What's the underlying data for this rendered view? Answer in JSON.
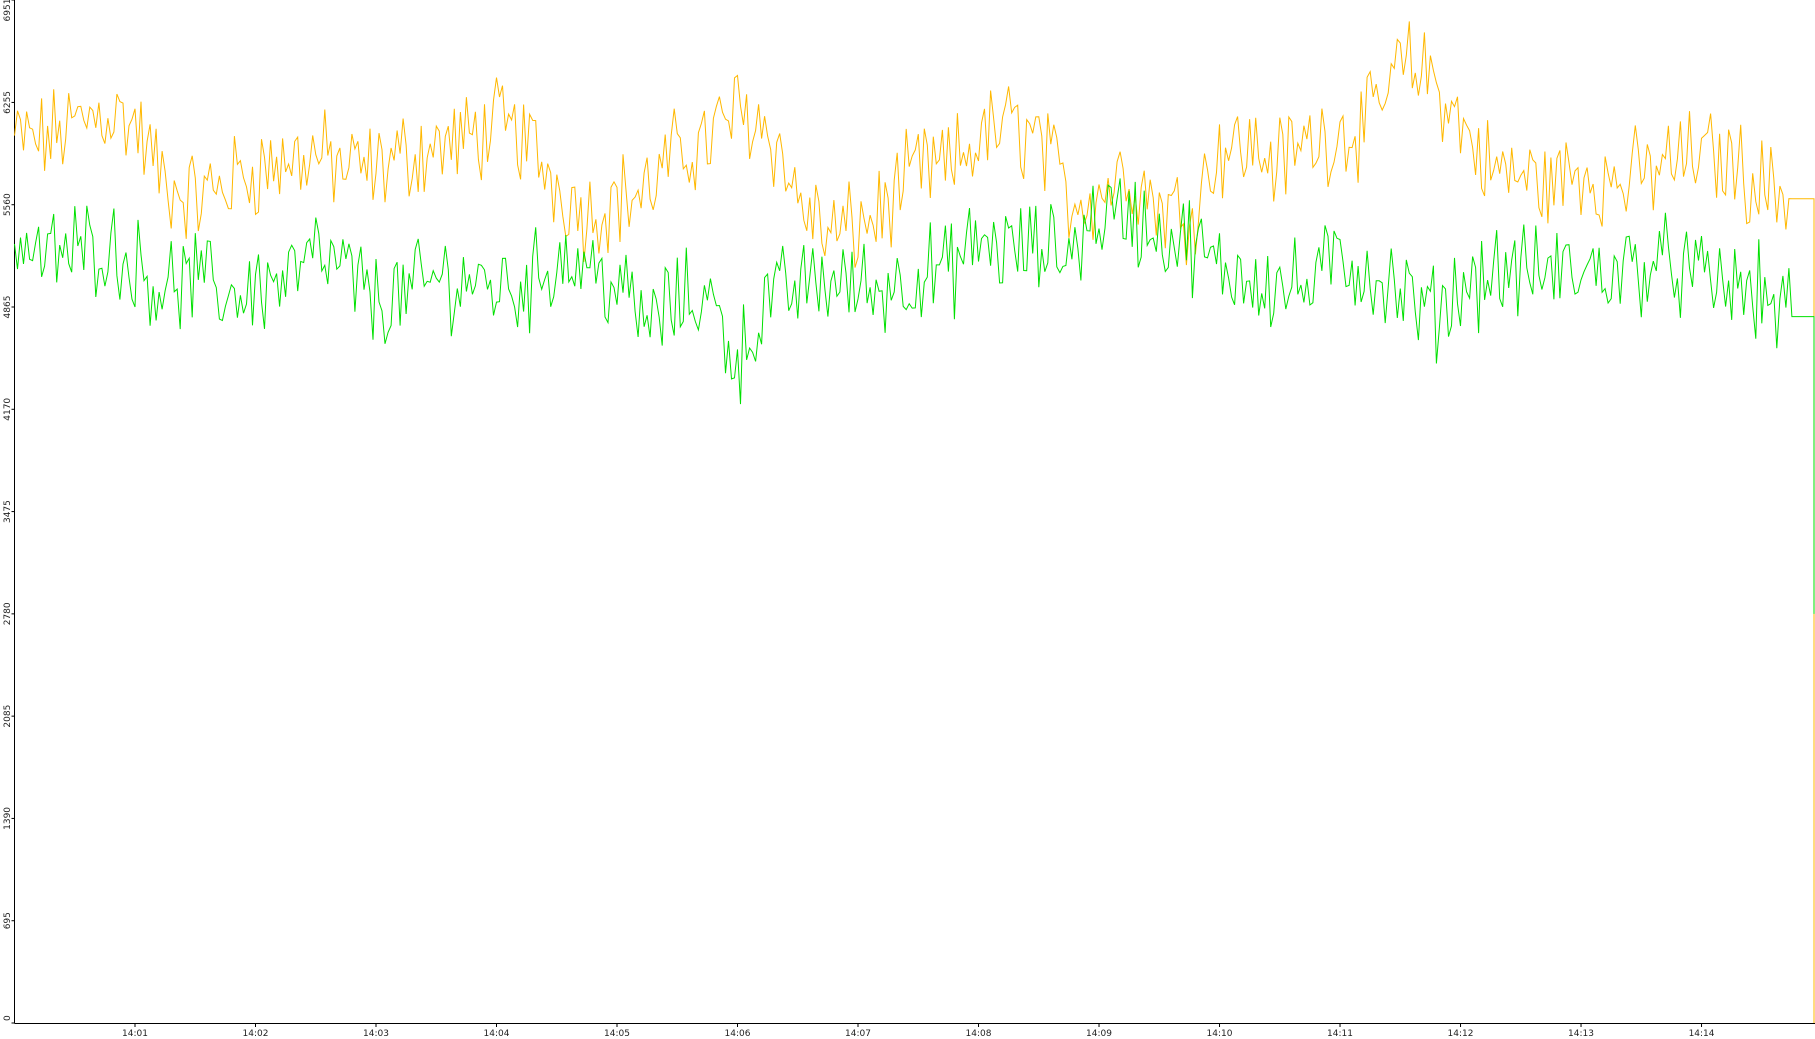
{
  "chart_data": {
    "type": "line",
    "title": "",
    "xlabel": "",
    "ylabel": "",
    "grid": false,
    "legend": "none",
    "background": "#ffffff",
    "x_tick_labels": [
      "14:01",
      "14:02",
      "14:03",
      "14:04",
      "14:05",
      "14:06",
      "14:07",
      "14:08",
      "14:09",
      "14:10",
      "14:11",
      "14:12",
      "14:13",
      "14:14"
    ],
    "y_tick_labels": [
      "0",
      "695",
      "1390",
      "2085",
      "2780",
      "3475",
      "4170",
      "4865",
      "5560",
      "6255",
      "6951"
    ],
    "ylim": [
      0,
      6951
    ],
    "xlim": [
      "14:00:00",
      "14:14:56"
    ],
    "series": [
      {
        "color": "#ffb800",
        "samples_per_minute": 4,
        "values": [
          6000,
          6000,
          6100,
          6200,
          6100,
          5700,
          5600,
          5700,
          5800,
          5850,
          5900,
          5800,
          5800,
          5900,
          5950,
          6000,
          6100,
          6000,
          5700,
          5500,
          5600,
          5650,
          5900,
          6000,
          6200,
          6100,
          5600,
          5350,
          5400,
          5550,
          5800,
          5800,
          6000,
          6100,
          6000,
          5600,
          5650,
          5800,
          5550,
          5500,
          5950,
          5950,
          5850,
          6000,
          6050,
          6100,
          6500,
          6450,
          6100,
          5800,
          5750,
          5700,
          5800,
          5700,
          5750,
          5850,
          5900,
          5850,
          5700,
          5600
        ],
        "end_value": 0
      },
      {
        "color": "#00e000",
        "samples_per_minute": 4,
        "values": [
          5300,
          5200,
          5250,
          5300,
          5150,
          5000,
          5050,
          4950,
          5000,
          5050,
          5200,
          5100,
          4900,
          4950,
          5050,
          5050,
          5000,
          5000,
          5200,
          5150,
          5000,
          4750,
          4900,
          4950,
          4500,
          4900,
          5000,
          5050,
          5000,
          5000,
          5100,
          5100,
          5300,
          5250,
          5250,
          5250,
          5500,
          5500,
          5350,
          5300,
          5100,
          5100,
          5000,
          5000,
          5200,
          5100,
          4950,
          4800,
          5000,
          5100,
          5100,
          5100,
          5100,
          5100,
          5150,
          5150,
          5050,
          5000,
          4950,
          4800
        ],
        "end_value": 2780
      }
    ]
  }
}
